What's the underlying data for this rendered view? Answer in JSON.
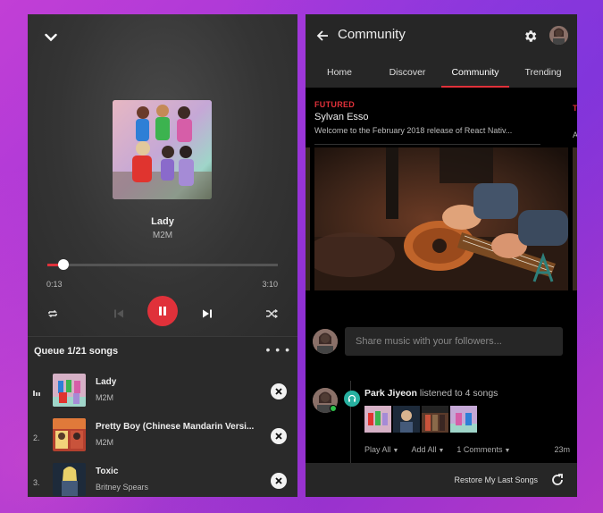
{
  "player": {
    "track_title": "Lady",
    "track_artist": "M2M",
    "time_current": "0:13",
    "time_total": "3:10",
    "progress": 0.07,
    "accent_color": "#e0313a",
    "icons": [
      "chevron-down-icon",
      "repeat-icon",
      "skip-previous-icon",
      "pause-icon",
      "skip-next-icon",
      "shuffle-icon"
    ]
  },
  "queue": {
    "header": "Queue 1/21 songs",
    "more": "• • •",
    "items": [
      {
        "index": "",
        "title": "Lady",
        "artist": "M2M",
        "playing": true
      },
      {
        "index": "2.",
        "title": "Pretty Boy (Chinese Mandarin Versi...",
        "artist": "M2M",
        "playing": false
      },
      {
        "index": "3.",
        "title": "Toxic",
        "artist": "Britney Spears",
        "playing": false
      }
    ]
  },
  "community": {
    "appbar_title": "Community",
    "tabs": [
      {
        "label": "Home",
        "active": false
      },
      {
        "label": "Discover",
        "active": false
      },
      {
        "label": "Community",
        "active": true
      },
      {
        "label": "Trending",
        "active": false
      }
    ],
    "featured": {
      "tag": "FUTURED",
      "artist": "Sylvan Esso",
      "description": "Welcome to the February 2018 release of React Nativ...",
      "next_tag": "T",
      "next_desc": "A"
    },
    "share_placeholder": "Share music with your followers...",
    "activity": {
      "user": "Park Jiyeon",
      "verb": " listened to ",
      "count": "4 songs",
      "actions": [
        {
          "label": "Play All"
        },
        {
          "label": "Add All"
        },
        {
          "label": "1 Comments"
        }
      ],
      "time": "23m"
    },
    "restore_label": "Restore My Last Songs"
  }
}
